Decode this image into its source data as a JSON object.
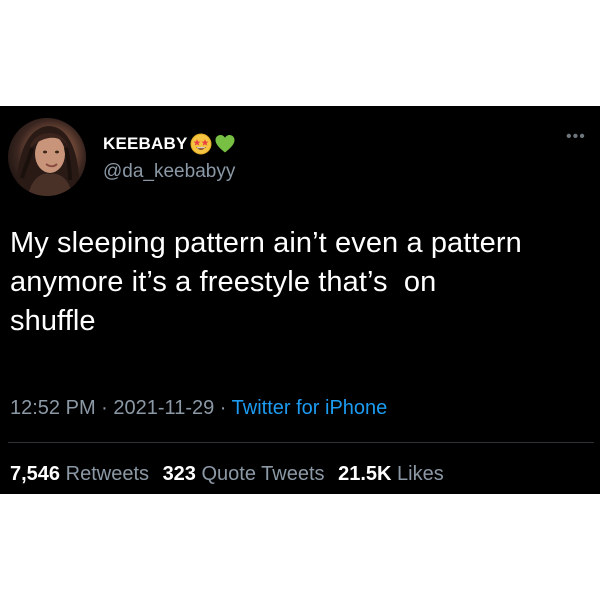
{
  "user": {
    "display_name": "KEEBABY",
    "handle": "@da_keebabyy",
    "badges": [
      "star-struck-emoji",
      "green-heart-emoji"
    ]
  },
  "tweet": {
    "text": "My sleeping pattern ain’t even a pattern\nanymore it’s a freestyle that’s  on\nshuffle",
    "time": "12:52 PM",
    "date": "2021-11-29",
    "separator": "·",
    "source": "Twitter for iPhone"
  },
  "stats": {
    "retweets_count": "7,546",
    "retweets_label": "Retweets",
    "quote_count": "323",
    "quote_label": "Quote Tweets",
    "likes_count": "21.5K",
    "likes_label": "Likes"
  },
  "icons": {
    "more": "more-icon"
  },
  "colors": {
    "background": "#000000",
    "text": "#ffffff",
    "muted": "#8b98a5",
    "link": "#1d9bf0",
    "divider": "#2f3336"
  }
}
